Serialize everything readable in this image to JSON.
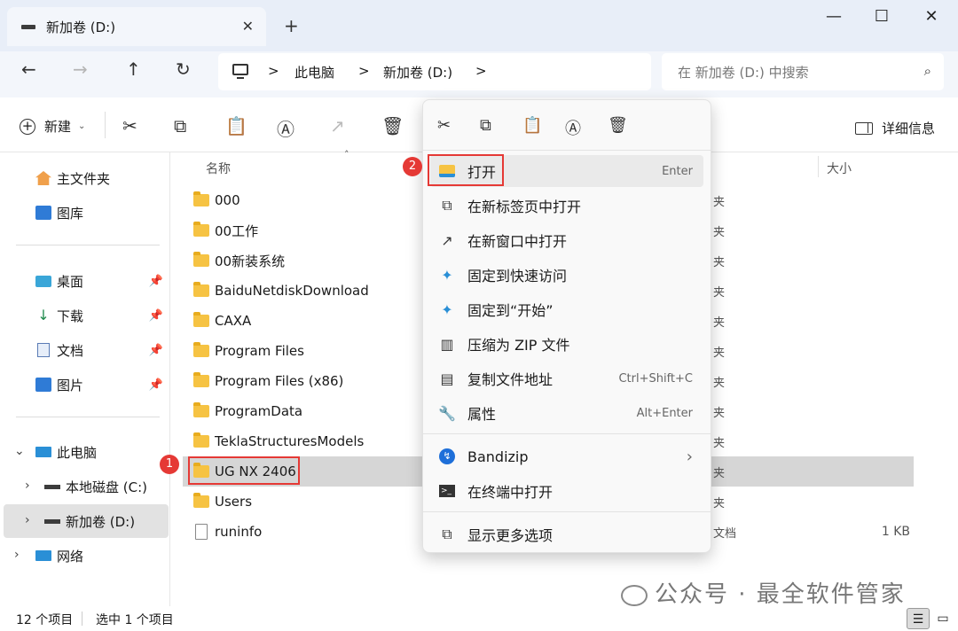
{
  "window": {
    "tab_title": "新加卷 (D:)",
    "tab_close": "✕",
    "new_tab": "+",
    "minimize": "—",
    "maximize": "☐",
    "close": "✕"
  },
  "nav": {
    "back": "←",
    "forward": "→",
    "up": "↑",
    "refresh": "↻"
  },
  "address": {
    "crumbs": [
      "此电脑",
      "新加卷 (D:)"
    ],
    "separators": [
      ">",
      ">",
      ">"
    ]
  },
  "search": {
    "placeholder": "在 新加卷 (D:) 中搜索",
    "icon": "search-icon"
  },
  "toolbar": {
    "new_label": "新建",
    "details_label": "详细信息",
    "icons": [
      "cut-icon",
      "copy-icon",
      "paste-icon",
      "rename-icon",
      "share-icon",
      "delete-icon"
    ]
  },
  "sidebar": {
    "items": [
      {
        "label": "主文件夹",
        "icon": "home-icon"
      },
      {
        "label": "图库",
        "icon": "gallery-icon"
      },
      {
        "label": "桌面",
        "icon": "desktop-icon",
        "pinned": true
      },
      {
        "label": "下载",
        "icon": "download-icon",
        "pinned": true
      },
      {
        "label": "文档",
        "icon": "document-icon",
        "pinned": true
      },
      {
        "label": "图片",
        "icon": "pictures-icon",
        "pinned": true
      },
      {
        "label": "此电脑",
        "icon": "computer-icon"
      },
      {
        "label": "本地磁盘 (C:)",
        "icon": "drive-icon"
      },
      {
        "label": "新加卷 (D:)",
        "icon": "drive-icon",
        "selected": true
      },
      {
        "label": "网络",
        "icon": "network-icon"
      }
    ],
    "pin_glyph": "📌"
  },
  "columns": {
    "name": "名称",
    "size": "大小"
  },
  "files": [
    {
      "name": "000",
      "type": "夹",
      "size": ""
    },
    {
      "name": "00工作",
      "type": "夹",
      "size": ""
    },
    {
      "name": "00新装系统",
      "type": "夹",
      "size": ""
    },
    {
      "name": "BaiduNetdiskDownload",
      "type": "夹",
      "size": ""
    },
    {
      "name": "CAXA",
      "type": "夹",
      "size": ""
    },
    {
      "name": "Program Files",
      "type": "夹",
      "size": ""
    },
    {
      "name": "Program Files (x86)",
      "type": "夹",
      "size": ""
    },
    {
      "name": "ProgramData",
      "type": "夹",
      "size": ""
    },
    {
      "name": "TeklaStructuresModels",
      "type": "夹",
      "size": ""
    },
    {
      "name": "UG NX 2406",
      "type": "夹",
      "size": "",
      "selected": true
    },
    {
      "name": "Users",
      "type": "夹",
      "size": ""
    },
    {
      "name": "runinfo",
      "type": "文档",
      "size": "1 KB",
      "is_file": true
    }
  ],
  "annotations": {
    "badge1": "1",
    "badge2": "2"
  },
  "context_menu": {
    "toolbar_icons": [
      "cut-icon",
      "copy-icon",
      "paste-icon",
      "rename-icon",
      "delete-icon"
    ],
    "items": [
      {
        "label": "打开",
        "accel": "Enter",
        "icon": "folder-open-icon"
      },
      {
        "label": "在新标签页中打开",
        "accel": "",
        "icon": "new-tab-icon"
      },
      {
        "label": "在新窗口中打开",
        "accel": "",
        "icon": "new-window-icon"
      },
      {
        "label": "固定到快速访问",
        "accel": "",
        "icon": "pin-icon"
      },
      {
        "label": "固定到“开始”",
        "accel": "",
        "icon": "pin-start-icon"
      },
      {
        "label": "压缩为 ZIP 文件",
        "accel": "",
        "icon": "zip-icon"
      },
      {
        "label": "复制文件地址",
        "accel": "Ctrl+Shift+C",
        "icon": "copy-path-icon"
      },
      {
        "label": "属性",
        "accel": "Alt+Enter",
        "icon": "properties-icon"
      },
      {
        "label": "Bandizip",
        "accel": "›",
        "icon": "bandizip-icon"
      },
      {
        "label": "在终端中打开",
        "accel": "",
        "icon": "terminal-icon"
      },
      {
        "label": "显示更多选项",
        "accel": "",
        "icon": "more-options-icon"
      }
    ]
  },
  "status": {
    "count": "12 个项目",
    "selected": "选中 1 个项目"
  },
  "watermark": "公众号 · 最全软件管家",
  "colors": {
    "accent": "#0067c0",
    "highlight_red": "#e53935",
    "folder": "#f6c343"
  }
}
